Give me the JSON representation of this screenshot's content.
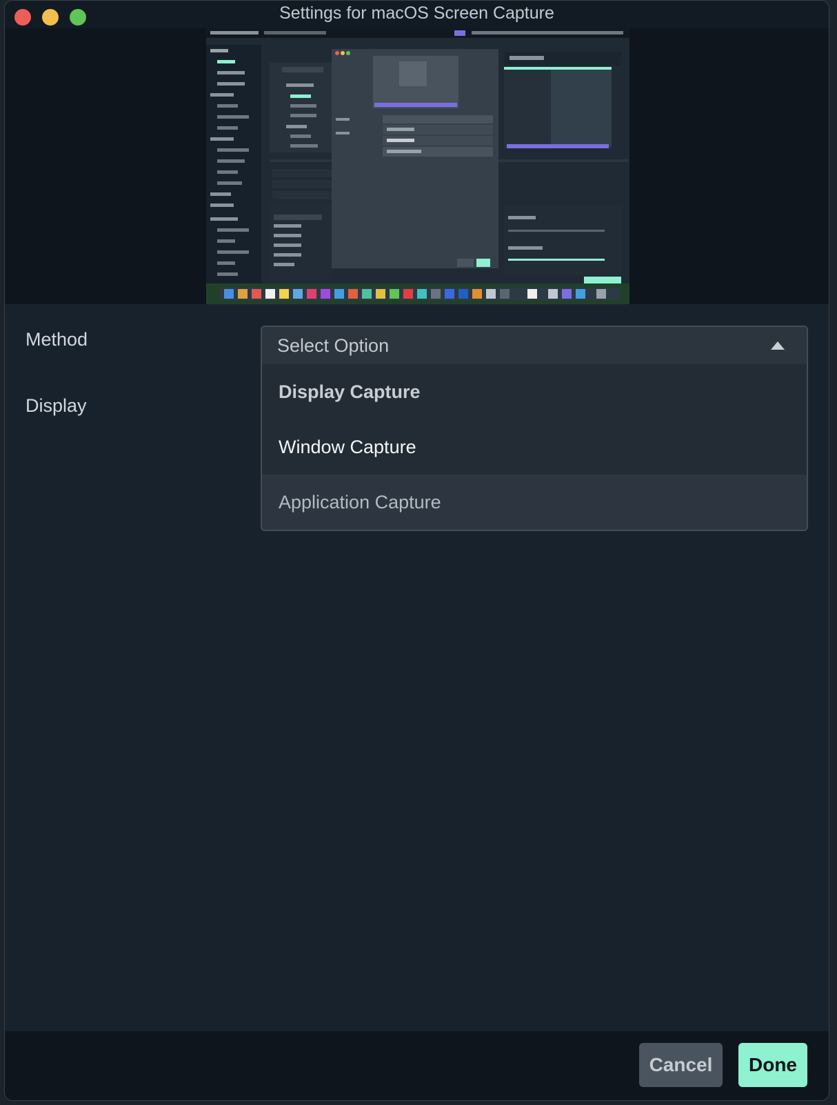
{
  "window": {
    "title": "Settings for macOS Screen Capture"
  },
  "form": {
    "method_label": "Method",
    "display_label": "Display"
  },
  "method_select": {
    "value": "Select Option",
    "options": [
      {
        "label": "Display Capture",
        "state": "selected"
      },
      {
        "label": "Window Capture",
        "state": "normal"
      },
      {
        "label": "Application Capture",
        "state": "hover"
      }
    ]
  },
  "footer": {
    "cancel_label": "Cancel",
    "done_label": "Done"
  },
  "colors": {
    "accent": "#8ef1d0",
    "close": "#ee5d59",
    "minimize": "#f4be4f",
    "maximize": "#5fc554",
    "panel": "#18222c"
  }
}
